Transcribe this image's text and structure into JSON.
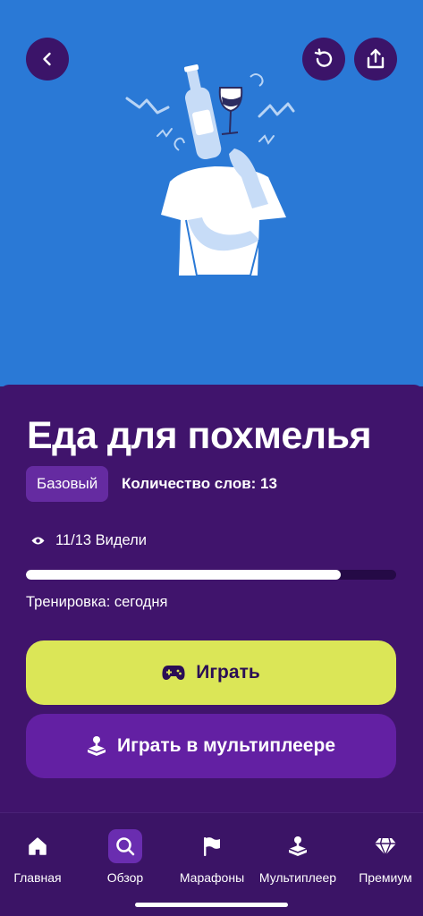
{
  "header": {
    "back_icon": "chevron-left-icon",
    "reset_icon": "refresh-icon",
    "share_icon": "share-icon",
    "hero_color": "#2a79d6"
  },
  "topic": {
    "title": "Еда для похмелья",
    "level": "Базовый",
    "word_count": "Количество слов: 13",
    "seen": "11/13 Видели",
    "seen_progress": 0.85,
    "training": "Тренировка: сегодня"
  },
  "actions": {
    "play_label": "Играть",
    "multiplayer_label": "Играть в мультиплеере",
    "play_color": "#dbe657",
    "multiplayer_color": "#6320a3"
  },
  "tabbar": {
    "items": [
      {
        "label": "Главная",
        "icon": "home-icon",
        "active": false
      },
      {
        "label": "Обзор",
        "icon": "search-icon",
        "active": true
      },
      {
        "label": "Марафоны",
        "icon": "flag-icon",
        "active": false
      },
      {
        "label": "Мультиплеер",
        "icon": "joystick-icon",
        "active": false
      },
      {
        "label": "Премиум",
        "icon": "diamond-icon",
        "active": false
      }
    ]
  }
}
